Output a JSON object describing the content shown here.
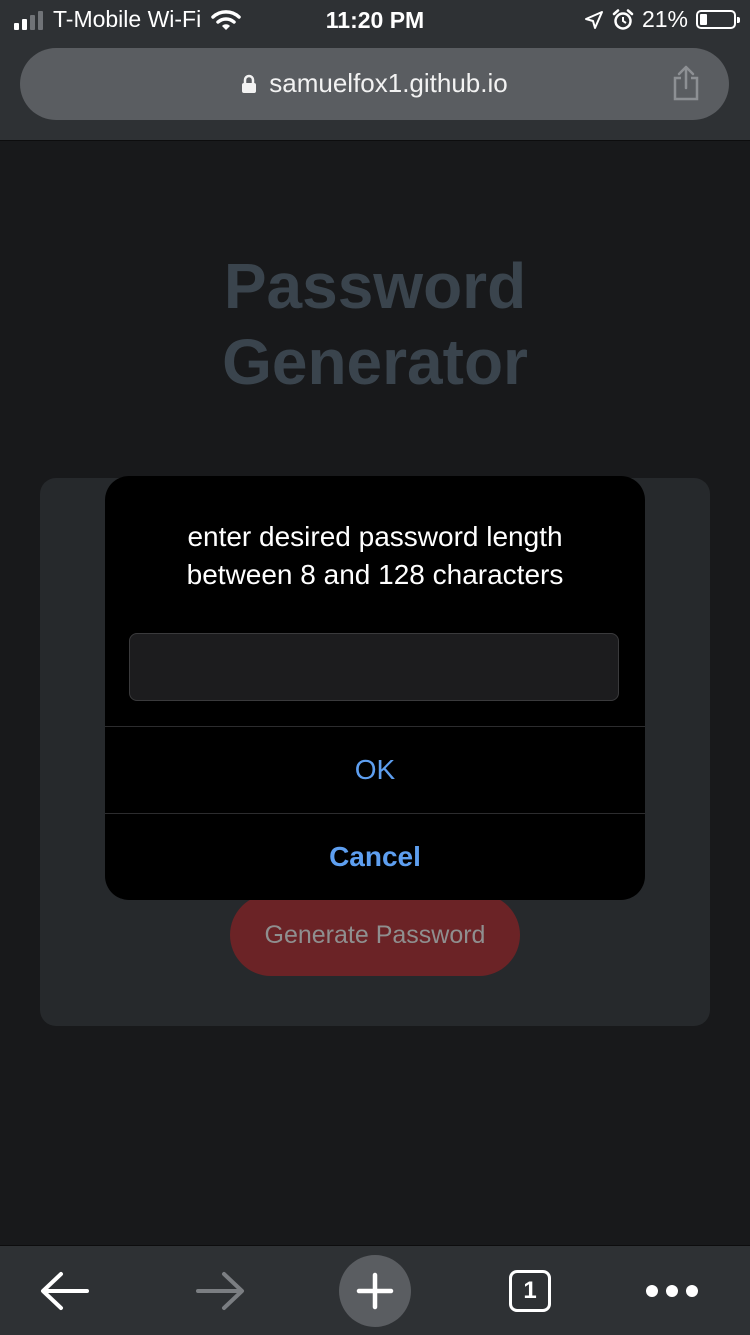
{
  "status_bar": {
    "carrier": "T-Mobile Wi-Fi",
    "time": "11:20 PM",
    "battery_percent": "21%",
    "battery_level": 0.21,
    "signal_bars_filled": 2,
    "icons": [
      "signal-icon",
      "wifi-icon",
      "location-arrow-icon",
      "alarm-icon",
      "battery-icon"
    ]
  },
  "address_bar": {
    "url": "samuelfox1.github.io",
    "icons": [
      "lock-icon",
      "share-icon"
    ]
  },
  "page": {
    "title_line1": "Password",
    "title_line2": "Generator",
    "generate_button_label": "Generate Password"
  },
  "dialog": {
    "message_line1": "enter desired password length",
    "message_line2": "between 8 and 128 characters",
    "input_value": "",
    "ok_label": "OK",
    "cancel_label": "Cancel"
  },
  "toolbar": {
    "tab_count": "1",
    "icons": [
      "back-arrow-icon",
      "forward-arrow-icon",
      "new-tab-plus-icon",
      "tabs-icon",
      "more-icon"
    ]
  },
  "colors": {
    "accent": "#5e9ff0",
    "generate_button": "#6b2326",
    "chrome": "#2e3134",
    "page_background": "#18191b"
  }
}
